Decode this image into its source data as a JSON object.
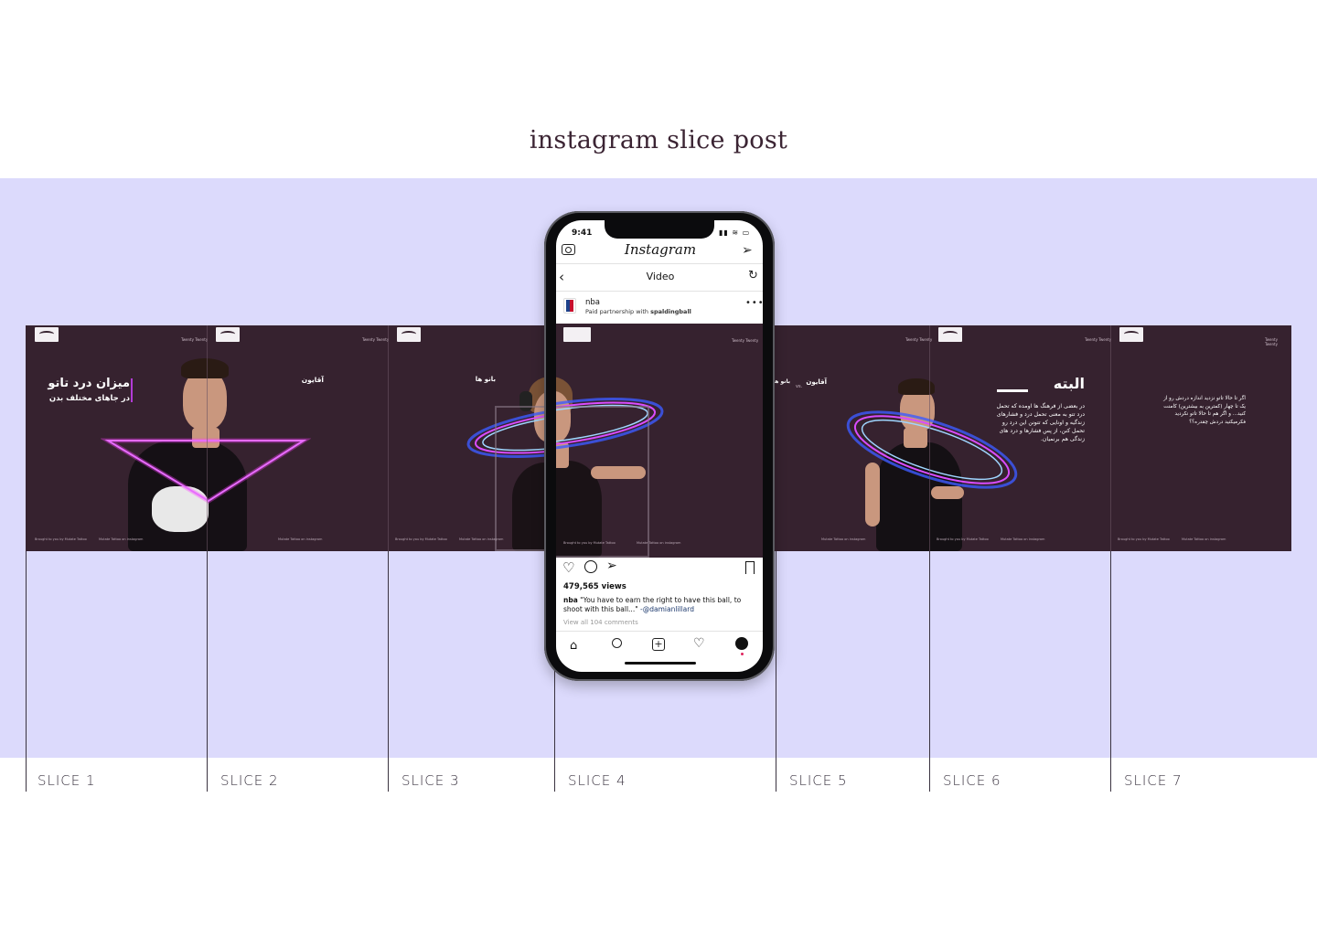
{
  "page": {
    "title": "instagram slice post"
  },
  "colors": {
    "band": "#dcdafc",
    "post_bg": "#36222f",
    "neon_pink": "#e02bff",
    "ring_blue": "#4a5bff"
  },
  "slices": [
    {
      "label": "SLICE 1"
    },
    {
      "label": "SLICE 2"
    },
    {
      "label": "SLICE 3"
    },
    {
      "label": "SLICE 4"
    },
    {
      "label": "SLICE 5"
    },
    {
      "label": "SLICE 6"
    },
    {
      "label": "SLICE 7"
    }
  ],
  "post": {
    "brand_tag": "Twenty Twenty",
    "slice1": {
      "title": "میزان درد تاتو",
      "subtitle": "در جاهای مختلف بدن"
    },
    "slice2": {
      "label": "آقایون"
    },
    "slice3": {
      "label": "بانو ها"
    },
    "slice5": {
      "label_a": "آقایون",
      "vs": "vs.",
      "label_b": "بانو ها"
    },
    "slice6": {
      "title": "البته",
      "body": "در بعضی از فرهنگ ها اومده که تحمل درد تتو به معنی تحمل درد و فشارهای زندگیه و اونایی که تتونن این درد رو تحمل کنن، از پس فشارها و درد های زندگی هم برنمیان."
    },
    "slice7": {
      "body": "اگر تا حالا تاتو نزدید اندازه دردش رو از یک تا چهار (کمترین به بیشترین) کامنت کنید... و اگر هم تا حالا تاتو نکردید فکرمیکنید دردش چقدره؟؟"
    },
    "footer_left": "Brought to you by Mutate Tattoo",
    "footer_right": "Mutate Tattoo on instagram"
  },
  "phone": {
    "time": "9:41",
    "brand": "Instagram",
    "nav_title": "Video",
    "username": "nba",
    "partnership_prefix": "Paid partnership with",
    "partner": "spaldingball",
    "views": "479,565 views",
    "caption_user": "nba",
    "caption_text": "\"You have to earn the right to have this ball, to shoot with this ball...\"",
    "caption_mention": "-@damianlillard",
    "comments_link": "View all 104 comments",
    "icons": [
      "camera-icon",
      "send-icon",
      "back-icon",
      "refresh-icon",
      "more-icon",
      "heart-icon",
      "comment-icon",
      "share-icon",
      "bookmark-icon",
      "home-icon",
      "search-icon",
      "add-icon",
      "activity-icon",
      "profile-icon"
    ]
  }
}
